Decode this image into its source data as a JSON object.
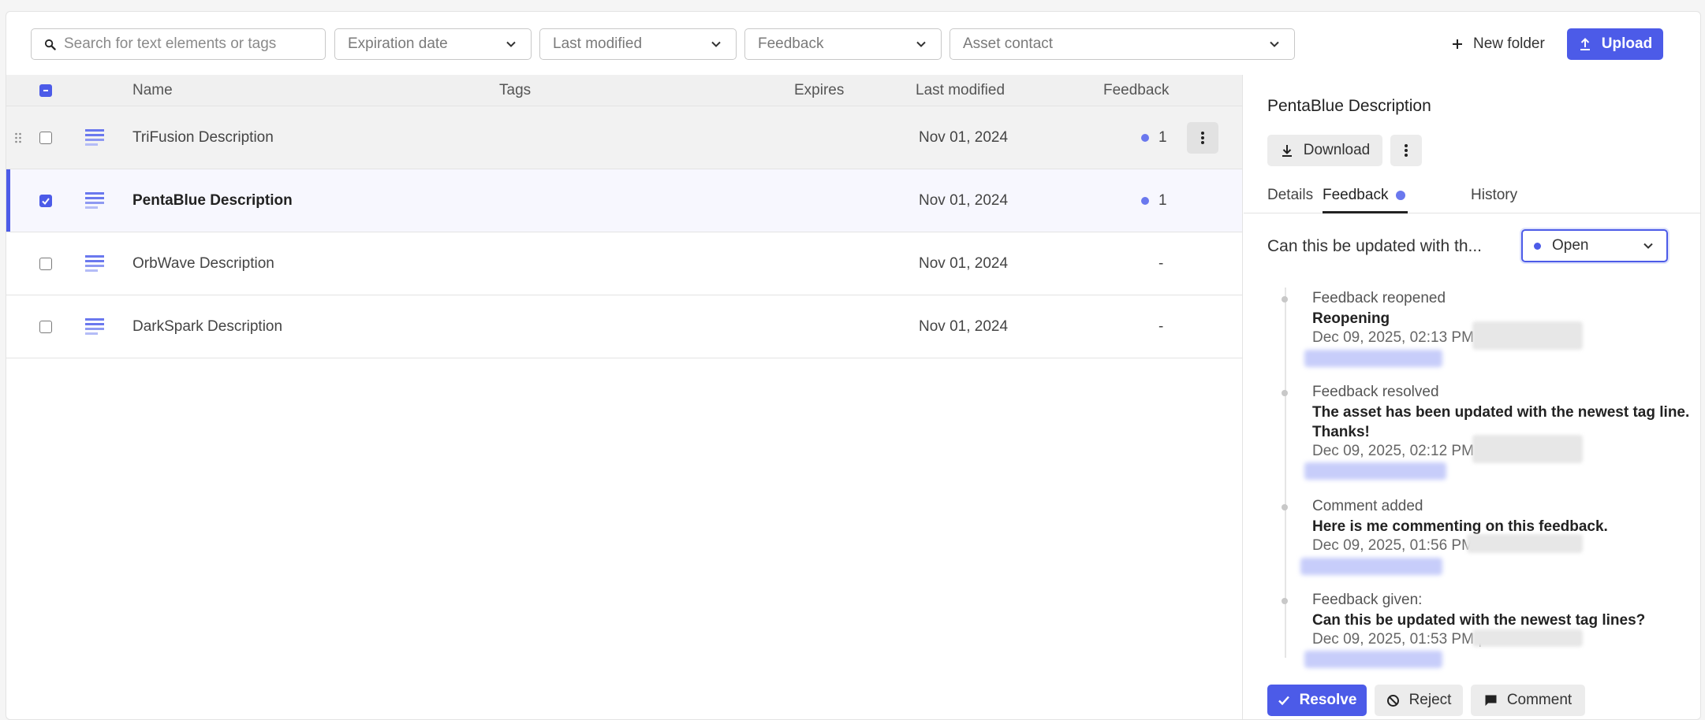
{
  "toolbar": {
    "search_placeholder": "Search for text elements or tags",
    "filters": [
      "Expiration date",
      "Last modified",
      "Feedback",
      "Asset contact"
    ],
    "new_folder_label": "New folder",
    "upload_label": "Upload"
  },
  "table": {
    "columns": {
      "name": "Name",
      "tags": "Tags",
      "expires": "Expires",
      "last_modified": "Last modified",
      "feedback": "Feedback"
    },
    "rows": [
      {
        "name": "TriFusion Description",
        "tags": "",
        "expires": "",
        "last_modified": "Nov 01, 2024",
        "feedback": "1",
        "checked": false
      },
      {
        "name": "PentaBlue Description",
        "tags": "",
        "expires": "",
        "last_modified": "Nov 01, 2024",
        "feedback": "1",
        "checked": true
      },
      {
        "name": "OrbWave Description",
        "tags": "",
        "expires": "",
        "last_modified": "Nov 01, 2024",
        "feedback": "-",
        "checked": false
      },
      {
        "name": "DarkSpark Description",
        "tags": "",
        "expires": "",
        "last_modified": "Nov 01, 2024",
        "feedback": "-",
        "checked": false
      }
    ]
  },
  "panel": {
    "title": "PentaBlue Description",
    "download_label": "Download",
    "tabs": [
      "Details",
      "Feedback",
      "History"
    ],
    "active_tab": "Feedback",
    "feedback_heading": "Can this be updated with th...",
    "status": "Open",
    "timeline": [
      {
        "type": "Feedback reopened",
        "message": "Reopening",
        "date": "Dec 09, 2025, 02:13 PM |"
      },
      {
        "type": "Feedback resolved",
        "message": "The asset has been updated with the newest tag line. Thanks!",
        "date": "Dec 09, 2025, 02:12 PM |"
      },
      {
        "type": "Comment added",
        "message": "Here is me commenting on this feedback.",
        "date": "Dec 09, 2025, 01:56 PM"
      },
      {
        "type": "Feedback given:",
        "message": "Can this be updated with the newest tag lines?",
        "date": "Dec 09, 2025, 01:53 PM |"
      }
    ],
    "actions": {
      "resolve": "Resolve",
      "reject": "Reject",
      "comment": "Comment"
    }
  },
  "colors": {
    "accent": "#4c5be8",
    "feedback_dot": "#6a78ee"
  }
}
